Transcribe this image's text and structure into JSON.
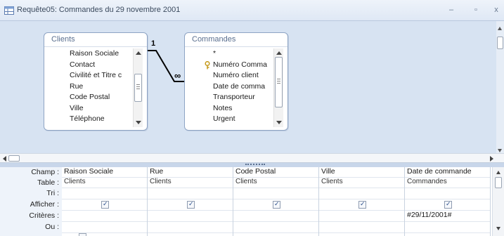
{
  "window": {
    "title": "Requête05: Commandes du 29 novembre 2001",
    "buttons": {
      "minimize": "–",
      "maximize": "▫",
      "close": "x"
    }
  },
  "tables": [
    {
      "name": "Clients",
      "fields": [
        "Raison Sociale",
        "Contact",
        "Civilité et Titre c",
        "Rue",
        "Code Postal",
        "Ville",
        "Téléphone"
      ]
    },
    {
      "name": "Commandes",
      "fields": [
        "*",
        "Numéro Comma",
        "Numéro client",
        "Date de comma",
        "Transporteur",
        "Notes",
        "Urgent"
      ],
      "key_field_index": 1
    }
  ],
  "relationship": {
    "one_label": "1",
    "many_label": "∞"
  },
  "qbe": {
    "row_labels": [
      "Champ :",
      "Table :",
      "Tri :",
      "Afficher :",
      "Critères :",
      "Ou :"
    ],
    "columns": [
      {
        "field": "Raison Sociale",
        "table": "Clients",
        "sort": "",
        "show": true,
        "criteria": ""
      },
      {
        "field": "Rue",
        "table": "Clients",
        "sort": "",
        "show": true,
        "criteria": ""
      },
      {
        "field": "Code Postal",
        "table": "Clients",
        "sort": "",
        "show": true,
        "criteria": ""
      },
      {
        "field": "Ville",
        "table": "Clients",
        "sort": "",
        "show": true,
        "criteria": ""
      },
      {
        "field": "Date de commande",
        "table": "Commandes",
        "sort": "",
        "show": true,
        "criteria": "#29/11/2001#"
      }
    ]
  },
  "colors": {
    "design_background": "#d7e3f2",
    "table_border": "#8ea4c4",
    "accent": "#2b4d8a"
  }
}
